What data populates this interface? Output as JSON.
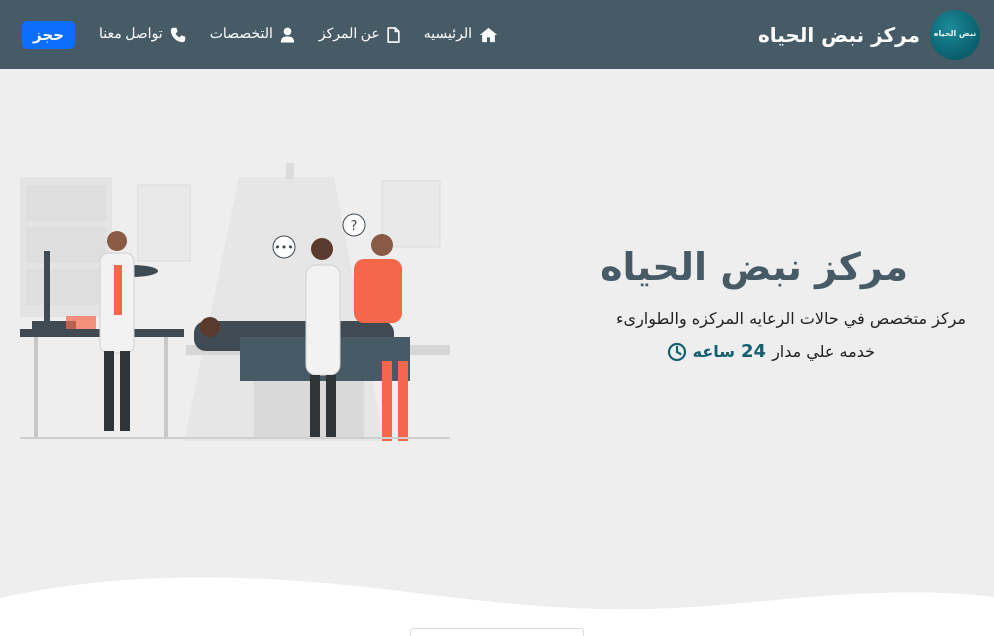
{
  "brand": {
    "name": "مركز نبض الحياه",
    "logo_text": "نبض الحياه"
  },
  "nav": {
    "items": [
      {
        "label": "الرئيسيه",
        "icon": "home-icon"
      },
      {
        "label": "عن المركز",
        "icon": "file-icon"
      },
      {
        "label": "التخصصات",
        "icon": "user-icon"
      },
      {
        "label": "تواصل معنا",
        "icon": "phone-icon"
      }
    ],
    "book_label": "حجز"
  },
  "hero": {
    "title": "مركز نبض الحياه",
    "subtitle": "مركز متخصص في حالات الرعايه المركزه والطوارىء",
    "hours_prefix": "خدمه علي مدار",
    "hours_number": "24",
    "hours_suffix": "ساعه",
    "illustration": "doctors-examining-patient-illustration"
  },
  "colors": {
    "navbar": "#475b66",
    "hero_bg": "#eeeeee",
    "accent": "#15606f",
    "button": "#0d6efd",
    "illustration_accent": "#f5674a"
  }
}
